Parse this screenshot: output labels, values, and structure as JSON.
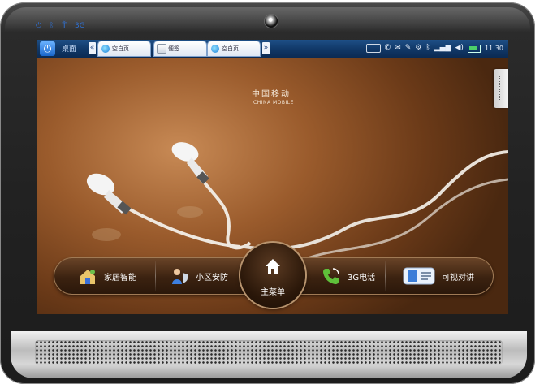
{
  "taskbar": {
    "desktop_label": "桌面",
    "tabs": [
      {
        "label": "空白页",
        "icon": "browser-icon"
      },
      {
        "label": "便签",
        "icon": "note-icon"
      },
      {
        "label": "空白页",
        "icon": "browser-icon"
      }
    ],
    "prev_glyph": "«",
    "next_glyph": "»",
    "clock": "11:30"
  },
  "operator": {
    "name_cn": "中国移动",
    "name_en": "CHINA MOBILE"
  },
  "dock": {
    "items": [
      {
        "label": "家居智能",
        "icon": "smart-home-icon"
      },
      {
        "label": "小区安防",
        "icon": "security-icon"
      },
      {
        "label": "3G电话",
        "icon": "phone-icon"
      },
      {
        "label": "可视对讲",
        "icon": "video-intercom-icon"
      }
    ],
    "home_label": "主菜单"
  },
  "colors": {
    "taskbar": "#103766",
    "wallpaper": "#9a5b2c",
    "dock": "#3b2210",
    "led": "#2f6fd0"
  }
}
